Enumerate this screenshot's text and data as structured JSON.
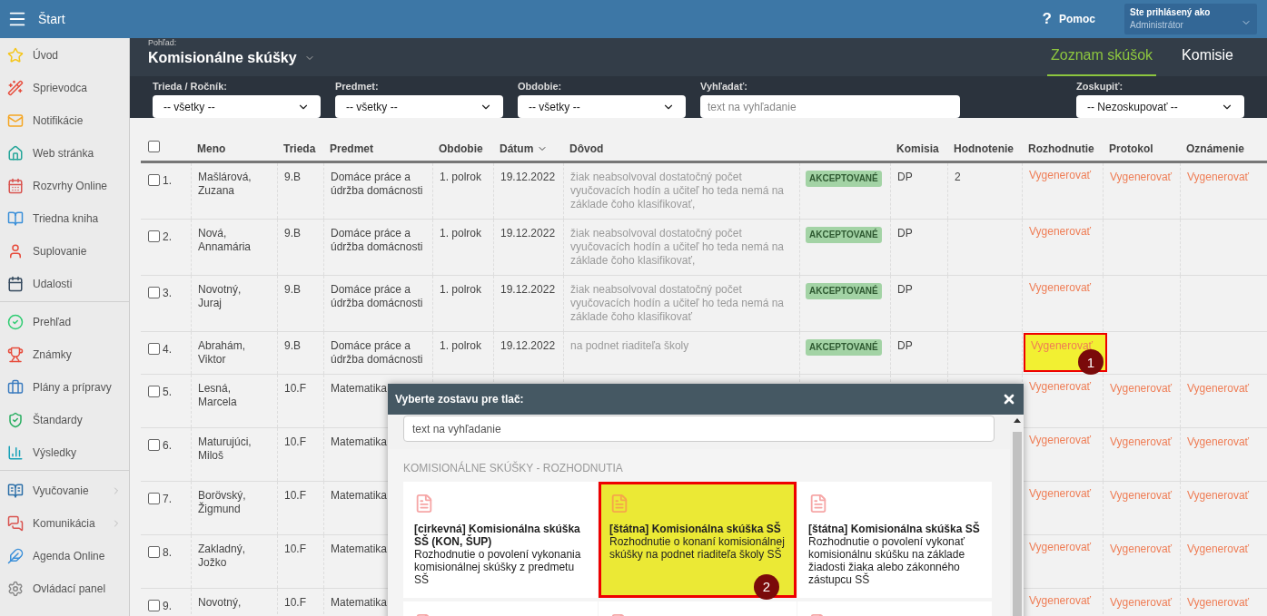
{
  "topbar": {
    "title": "Štart",
    "help_icon": "?",
    "help": "Pomoc",
    "user_label": "Ste prihlásený ako",
    "user_name": "Administrátor"
  },
  "sidebar": {
    "groups": [
      {
        "items": [
          {
            "label": "Úvod"
          },
          {
            "label": "Sprievodca"
          },
          {
            "label": "Notifikácie"
          },
          {
            "label": "Web stránka"
          },
          {
            "label": "Rozvrhy Online"
          },
          {
            "label": "Triedna kniha"
          },
          {
            "label": "Suplovanie"
          },
          {
            "label": "Udalosti"
          }
        ]
      },
      {
        "items": [
          {
            "label": "Prehľad"
          },
          {
            "label": "Známky"
          },
          {
            "label": "Plány a prípravy"
          },
          {
            "label": "Štandardy"
          },
          {
            "label": "Výsledky"
          }
        ]
      },
      {
        "items": [
          {
            "label": "Vyučovanie",
            "submenu": true
          },
          {
            "label": "Komunikácia",
            "submenu": true
          },
          {
            "label": "Agenda Online",
            "submenu": false
          },
          {
            "label": "Ovládací panel",
            "submenu": false
          }
        ]
      }
    ]
  },
  "view": {
    "label": "Pohľad:",
    "title": "Komisionálne skúšky"
  },
  "tabs": [
    {
      "label": "Zoznam skúšok",
      "selected": true
    },
    {
      "label": "Komisie",
      "selected": false
    }
  ],
  "filters": [
    {
      "kind": "select",
      "label": "Trieda / Ročník:",
      "value": "-- všetky --"
    },
    {
      "kind": "select",
      "label": "Predmet:",
      "value": "-- všetky --"
    },
    {
      "kind": "select",
      "label": "Obdobie:",
      "value": "-- všetky --"
    },
    {
      "kind": "input",
      "label": "Vyhľadať:",
      "placeholder": "text na vyhľadanie"
    },
    {
      "kind": "select",
      "label": "Zoskupiť:",
      "value": "-- Nezoskupovať --"
    }
  ],
  "table": {
    "select_all": {
      "checked": false
    },
    "columns": [
      {
        "label": "Meno",
        "sorted": false
      },
      {
        "label": "Trieda",
        "sorted": false
      },
      {
        "label": "Predmet",
        "sorted": false
      },
      {
        "label": "Obdobie",
        "sorted": false
      },
      {
        "label": "Dátum",
        "sorted": true
      },
      {
        "label": "Dôvod",
        "sorted": false
      },
      {
        "label": "Komisia",
        "sorted": false
      },
      {
        "label": "Hodnotenie",
        "sorted": false
      },
      {
        "label": "Rozhodnutie",
        "sorted": false
      },
      {
        "label": "Protokol",
        "sorted": false
      },
      {
        "label": "Oznámenie",
        "sorted": false
      }
    ],
    "rows": [
      {
        "checked": false,
        "number": "1.",
        "name": "Mašlárová, Zuzana",
        "class": "9.B",
        "subject": "Domáce práce a údržba domácnosti",
        "period": "1. polrok",
        "date": "19.12.2022",
        "reason": "žiak neabsolvoval dostatočný počet vyučovacích hodín a učiteľ ho teda nemá na základe čoho klasifikovať,",
        "status": "AKCEPTOVANÉ",
        "commission": "DP",
        "grade": "2",
        "decision": "Vygenerovať",
        "protocol": "Vygenerovať",
        "notice": "Vygenerovať"
      },
      {
        "checked": false,
        "number": "2.",
        "name": "Nová, Annamária",
        "class": "9.B",
        "subject": "Domáce práce a údržba domácnosti",
        "period": "1. polrok",
        "date": "19.12.2022",
        "reason": "žiak neabsolvoval dostatočný počet vyučovacích hodín a učiteľ ho teda nemá na základe čoho klasifikovať,",
        "status": "AKCEPTOVANÉ",
        "commission": "DP",
        "decision": "Vygenerovať"
      },
      {
        "checked": false,
        "number": "3.",
        "name": "Novotný, Juraj",
        "class": "9.B",
        "subject": "Domáce práce a údržba domácnosti",
        "period": "1. polrok",
        "date": "19.12.2022",
        "reason": "žiak neabsolvoval dostatočný počet vyučovacích hodín a učiteľ ho teda nemá na základe čoho klasifikovať",
        "status": "AKCEPTOVANÉ",
        "commission": "DP",
        "decision": "Vygenerovať"
      },
      {
        "checked": false,
        "number": "4.",
        "name": "Abrahám, Viktor",
        "class": "9.B",
        "subject": "Domáce práce a údržba domácnosti",
        "period": "1. polrok",
        "date": "19.12.2022",
        "reason": "na podnet riaditeľa školy",
        "status": "AKCEPTOVANÉ",
        "commission": "DP",
        "decision": "Vygenerovať",
        "decision_highlighted": true,
        "decision_marker": "1"
      },
      {
        "checked": false,
        "number": "5.",
        "name": "Lesná, Marcela",
        "class": "10.F",
        "subject": "Matematika",
        "decision": "Vygenerovať",
        "protocol": "Vygenerovať",
        "notice": "Vygenerovať"
      },
      {
        "checked": false,
        "number": "6.",
        "name": "Maturujúci, Miloš",
        "class": "10.F",
        "subject": "Matematika",
        "decision": "Vygenerovať",
        "protocol": "Vygenerovať",
        "notice": "Vygenerovať"
      },
      {
        "checked": false,
        "number": "7.",
        "name": "Borövský, Žigmund",
        "class": "10.F",
        "subject": "Matematika",
        "decision": "Vygenerovať",
        "protocol": "Vygenerovať",
        "notice": "Vygenerovať"
      },
      {
        "checked": false,
        "number": "8.",
        "name": "Zakladný, Jožko",
        "class": "10.F",
        "subject": "Matematika",
        "decision": "Vygenerovať",
        "protocol": "Vygenerovať",
        "notice": "Vygenerovať"
      },
      {
        "checked": false,
        "number": "9.",
        "name": "Novotný,",
        "class": "10.F",
        "subject": "Matematika",
        "decision": "Vygenerovať",
        "protocol": "Vygenerovať",
        "notice": "Vygenerovať"
      }
    ]
  },
  "dialog": {
    "title": "Vyberte zostavu pre tlač:",
    "search_placeholder": "text na vyhľadanie",
    "section": "KOMISIONÁLNE SKÚŠKY - ROZHODNUTIA",
    "cards": [
      {
        "kind": "report",
        "title": "[cirkevná] Komisionálna skúška SŠ (KON, ŠUP)",
        "description": "Rozhodnutie o povolení vykonania komisionálnej skúšky z predmetu SŠ",
        "highlighted": false
      },
      {
        "kind": "report",
        "title": "[štátna] Komisionálna skúška SŠ",
        "description": "Rozhodnutie o konaní komisionálnej skúšky na podnet riaditeľa školy SŠ",
        "highlighted": true,
        "marker": "2"
      },
      {
        "kind": "report",
        "title": "[štátna] Komisionálna skúška SŠ",
        "description": "Rozhodnutie o povolení vykonať komisionálnu skúšku na základe žiadosti žiaka alebo zákonného zástupcu SŠ",
        "highlighted": false
      },
      {
        "kind": "partial",
        "highlighted": false
      },
      {
        "kind": "partial",
        "highlighted": false
      },
      {
        "kind": "partial",
        "highlighted": false
      }
    ]
  }
}
